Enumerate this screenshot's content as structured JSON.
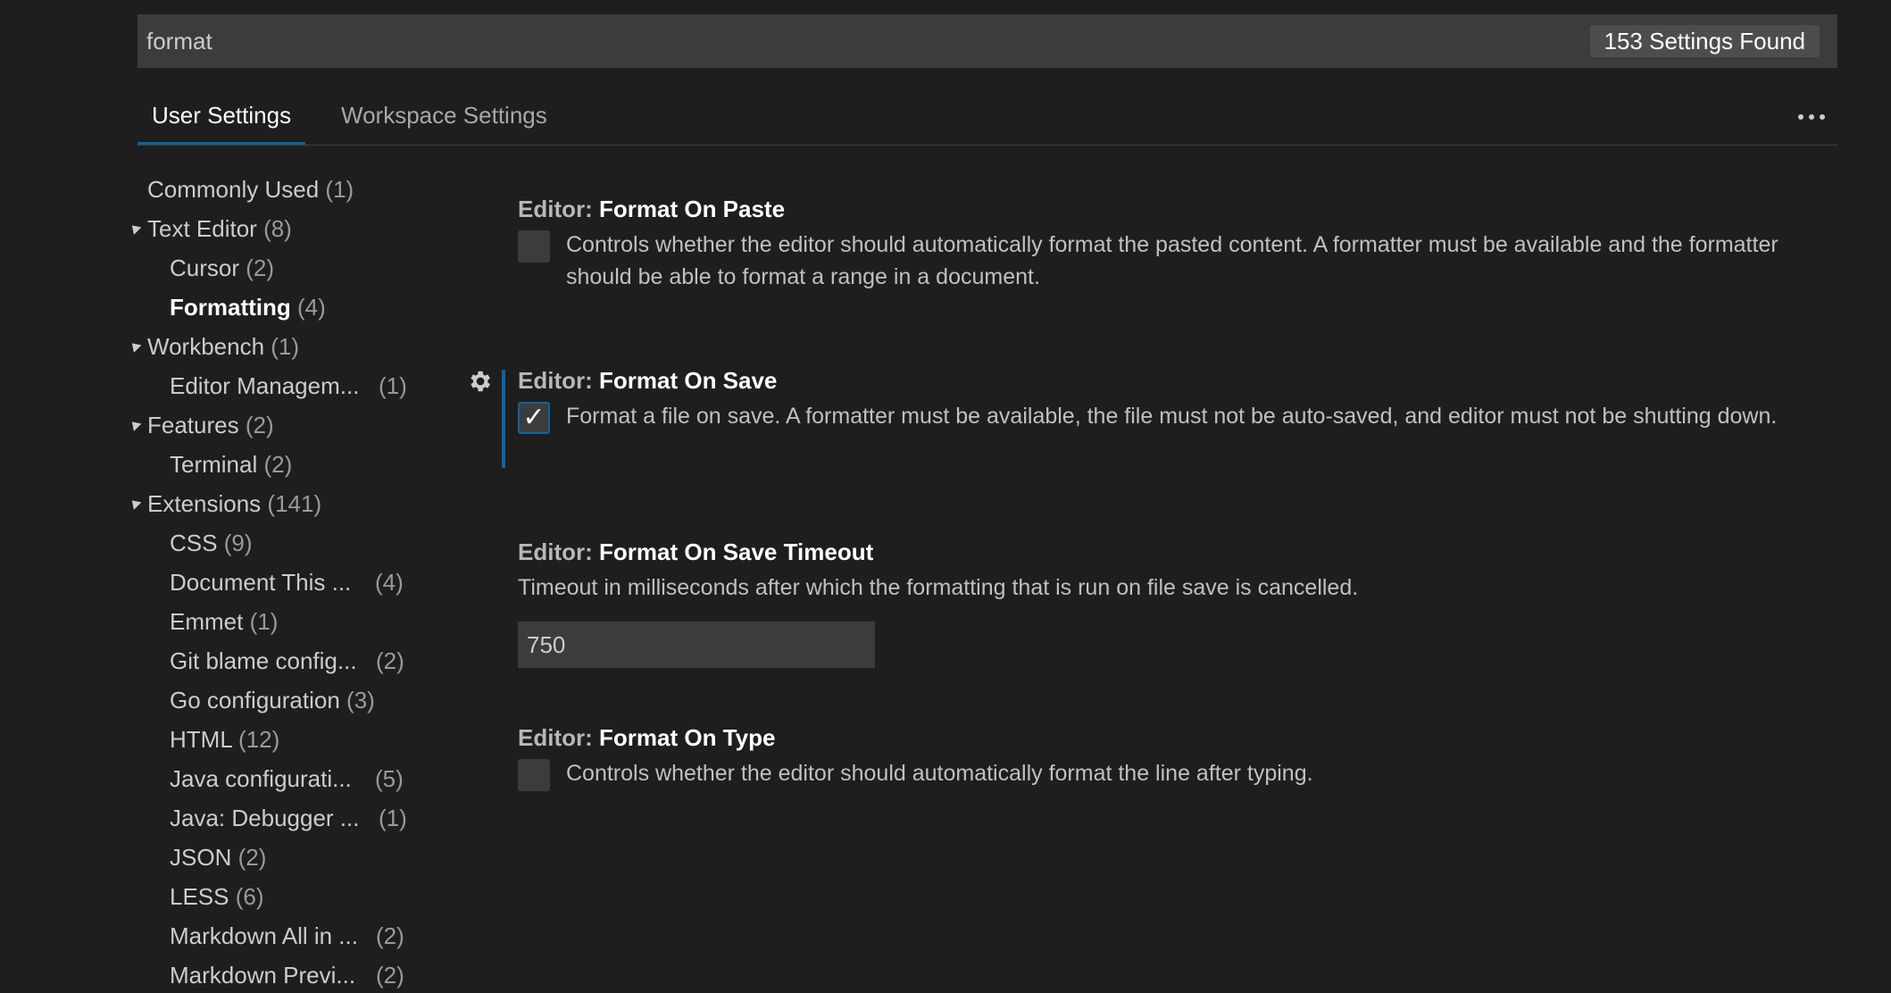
{
  "search": {
    "value": "format",
    "results_count": "153 Settings Found"
  },
  "tabs": {
    "user": "User Settings",
    "workspace": "Workspace Settings"
  },
  "more_icon": "ellipsis-icon",
  "toc": [
    {
      "name": "Commonly Used",
      "count": "(1)"
    },
    {
      "name": "Text Editor",
      "count": "(8)"
    },
    {
      "name": "Cursor",
      "count": "(2)"
    },
    {
      "name": "Formatting",
      "count": "(4)"
    },
    {
      "name": "Workbench",
      "count": "(1)"
    },
    {
      "name": "Editor Managem...",
      "count": "(1)"
    },
    {
      "name": "Features",
      "count": "(2)"
    },
    {
      "name": "Terminal",
      "count": "(2)"
    },
    {
      "name": "Extensions",
      "count": "(141)"
    },
    {
      "name": "CSS",
      "count": "(9)"
    },
    {
      "name": "Document This ...",
      "count": "(4)"
    },
    {
      "name": "Emmet",
      "count": "(1)"
    },
    {
      "name": "Git blame config...",
      "count": "(2)"
    },
    {
      "name": "Go configuration",
      "count": "(3)"
    },
    {
      "name": "HTML",
      "count": "(12)"
    },
    {
      "name": "Java configurati...",
      "count": "(5)"
    },
    {
      "name": "Java: Debugger ...",
      "count": "(1)"
    },
    {
      "name": "JSON",
      "count": "(2)"
    },
    {
      "name": "LESS",
      "count": "(6)"
    },
    {
      "name": "Markdown All in ...",
      "count": "(2)"
    },
    {
      "name": "Markdown Previ...",
      "count": "(2)"
    }
  ],
  "settings": {
    "paste": {
      "category": "Editor:",
      "key": "Format On Paste",
      "description": "Controls whether the editor should automatically format the pasted content. A formatter must be available and the formatter should be able to format a range in a document.",
      "checked": false
    },
    "save": {
      "category": "Editor:",
      "key": "Format On Save",
      "description": "Format a file on save. A formatter must be available, the file must not be auto-saved, and editor must not be shutting down.",
      "checked": true,
      "check_mark": "✓"
    },
    "save_timeout": {
      "category": "Editor:",
      "key": "Format On Save Timeout",
      "description": "Timeout in milliseconds after which the formatting that is run on file save is cancelled.",
      "value": "750"
    },
    "type": {
      "category": "Editor:",
      "key": "Format On Type",
      "description": "Controls whether the editor should automatically format the line after typing.",
      "checked": false
    }
  },
  "colors": {
    "background": "#1e1e1e",
    "accent": "#0e639c",
    "input_background": "#3c3c3c"
  }
}
